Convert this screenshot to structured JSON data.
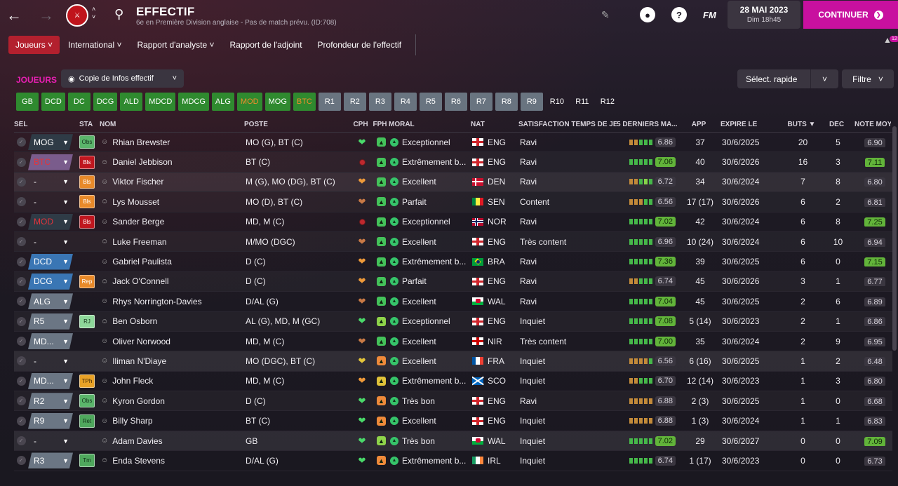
{
  "header": {
    "title": "EFFECTIF",
    "subtitle": "6e en Première Division anglaise - Pas de match prévu. (ID:708)",
    "date": "28 MAI 2023",
    "day_time": "Dim 18h45",
    "continue_label": "CONTINUER",
    "fm_logo": "FM",
    "help_label": "?",
    "notif_count": "12"
  },
  "menu": [
    "Joueurs",
    "International",
    "Rapport d'analyste",
    "Rapport de l'adjoint",
    "Profondeur de l'effectif"
  ],
  "section": {
    "title": "JOUEURS",
    "view": "Copie de Infos effectif",
    "quick_select": "Sélect. rapide",
    "filter": "Filtre"
  },
  "positions": [
    {
      "label": "GB",
      "style": "green"
    },
    {
      "label": "DCD",
      "style": "green"
    },
    {
      "label": "DC",
      "style": "green"
    },
    {
      "label": "DCG",
      "style": "green"
    },
    {
      "label": "ALD",
      "style": "green"
    },
    {
      "label": "MDCD",
      "style": "green"
    },
    {
      "label": "MDCG",
      "style": "green"
    },
    {
      "label": "ALG",
      "style": "green"
    },
    {
      "label": "MOD",
      "style": "orange"
    },
    {
      "label": "MOG",
      "style": "green"
    },
    {
      "label": "BTC",
      "style": "orange"
    },
    {
      "label": "R1",
      "style": "grey"
    },
    {
      "label": "R2",
      "style": "grey"
    },
    {
      "label": "R3",
      "style": "grey"
    },
    {
      "label": "R4",
      "style": "grey"
    },
    {
      "label": "R5",
      "style": "grey"
    },
    {
      "label": "R6",
      "style": "grey"
    },
    {
      "label": "R7",
      "style": "grey"
    },
    {
      "label": "R8",
      "style": "grey"
    },
    {
      "label": "R9",
      "style": "grey"
    },
    {
      "label": "R10",
      "style": "dark"
    },
    {
      "label": "R11",
      "style": "dark"
    },
    {
      "label": "R12",
      "style": "dark"
    }
  ],
  "columns": {
    "sel": "SÉL",
    "sta": "STA",
    "nom": "NOM",
    "poste": "POSTE",
    "cph": "CPH",
    "fph": "FPH",
    "moral": "MORAL",
    "nat": "NAT",
    "sat": "SATISFACTION TEMPS DE JEU",
    "form": "5 DERNIERS MA...",
    "app": "APP",
    "exp": "EXPIRE LE",
    "buts": "BUTS",
    "dec": "DÉC",
    "moy": "NOTE MOY"
  },
  "players": [
    {
      "pos": "MOG",
      "pos_style": "dark",
      "sta": "Obs",
      "sta_style": "obs",
      "name": "Rhian Brewster",
      "poste": "MO (G), BT (C)",
      "cph": "heart-g",
      "fph": "g",
      "moral": "Exceptionnel",
      "nat": "ENG",
      "sat": "Ravi",
      "form": "ooggg",
      "fr": "6.86",
      "fr_hi": false,
      "app": "37",
      "exp": "30/6/2025",
      "buts": "20",
      "dec": "5",
      "moy": "6.90",
      "moy_hi": false
    },
    {
      "pos": "BTC",
      "pos_style": "purple",
      "pos_red": true,
      "sta": "Bls",
      "sta_style": "bls",
      "name": "Daniel Jebbison",
      "poste": "BT (C)",
      "cph": "dot",
      "fph": "g",
      "moral": "Extrêmement b...",
      "nat": "ENG",
      "sat": "Ravi",
      "form": "ggggg",
      "fr": "7.06",
      "fr_hi": true,
      "app": "40",
      "exp": "30/6/2026",
      "buts": "16",
      "dec": "3",
      "moy": "7.11",
      "moy_hi": true
    },
    {
      "pos": "-",
      "pos_style": "none",
      "sta": "Bls",
      "sta_style": "bls-o",
      "name": "Viktor Fischer",
      "poste": "M (G), MO (DG), BT (C)",
      "cph": "heart-o",
      "fph": "g",
      "moral": "Excellent",
      "nat": "DEN",
      "sat": "Ravi",
      "form": "oogLg",
      "fr": "6.72",
      "fr_hi": false,
      "app": "34",
      "exp": "30/6/2024",
      "buts": "7",
      "dec": "8",
      "moy": "6.80",
      "moy_hi": false
    },
    {
      "pos": "-",
      "pos_style": "none",
      "sta": "Bls",
      "sta_style": "bls-o",
      "name": "Lys Mousset",
      "poste": "MO (D), BT (C)",
      "cph": "heart-b",
      "fph": "g",
      "moral": "Parfait",
      "nat": "SEN",
      "sat": "Content",
      "form": "ooogg",
      "fr": "6.56",
      "fr_hi": false,
      "app": "17 (17)",
      "exp": "30/6/2026",
      "buts": "6",
      "dec": "2",
      "moy": "6.81",
      "moy_hi": false
    },
    {
      "pos": "MOD",
      "pos_style": "dark",
      "pos_red": true,
      "sta": "Bls",
      "sta_style": "bls",
      "name": "Sander Berge",
      "poste": "MD, M (C)",
      "cph": "dot",
      "fph": "g",
      "moral": "Exceptionnel",
      "nat": "NOR",
      "sat": "Ravi",
      "form": "ggggg",
      "fr": "7.02",
      "fr_hi": true,
      "app": "42",
      "exp": "30/6/2024",
      "buts": "6",
      "dec": "8",
      "moy": "7.25",
      "moy_hi": true
    },
    {
      "pos": "-",
      "pos_style": "none",
      "sta": "",
      "sta_style": "",
      "name": "Luke Freeman",
      "poste": "M/MO (DGC)",
      "cph": "heart-b",
      "fph": "g",
      "moral": "Excellent",
      "nat": "ENG",
      "sat": "Très content",
      "form": "ggggg",
      "fr": "6.96",
      "fr_hi": false,
      "app": "10 (24)",
      "exp": "30/6/2024",
      "buts": "6",
      "dec": "10",
      "moy": "6.94",
      "moy_hi": false
    },
    {
      "pos": "DCD",
      "pos_style": "blue",
      "sta": "",
      "sta_style": "",
      "name": "Gabriel Paulista",
      "poste": "D (C)",
      "cph": "heart-o",
      "fph": "g",
      "moral": "Extrêmement b...",
      "nat": "BRA",
      "sat": "Ravi",
      "form": "ggggg",
      "fr": "7.36",
      "fr_hi": true,
      "app": "39",
      "exp": "30/6/2025",
      "buts": "6",
      "dec": "0",
      "moy": "7.15",
      "moy_hi": true
    },
    {
      "pos": "DCG",
      "pos_style": "blue",
      "sta": "Rep",
      "sta_style": "rep",
      "name": "Jack O'Connell",
      "poste": "D (C)",
      "cph": "heart-o",
      "fph": "g",
      "moral": "Parfait",
      "nat": "ENG",
      "sat": "Ravi",
      "form": "oogg g",
      "fr": "6.74",
      "fr_hi": false,
      "app": "45",
      "exp": "30/6/2026",
      "buts": "3",
      "dec": "1",
      "moy": "6.77",
      "moy_hi": false
    },
    {
      "pos": "ALG",
      "pos_style": "grey",
      "sta": "",
      "sta_style": "",
      "name": "Rhys Norrington-Davies",
      "poste": "D/AL (G)",
      "cph": "heart-b",
      "fph": "g",
      "moral": "Excellent",
      "nat": "WAL",
      "sat": "Ravi",
      "form": "ggggg",
      "fr": "7.04",
      "fr_hi": true,
      "app": "45",
      "exp": "30/6/2025",
      "buts": "2",
      "dec": "6",
      "moy": "6.89",
      "moy_hi": false
    },
    {
      "pos": "R5",
      "pos_style": "grey",
      "sta": "RJ",
      "sta_style": "rj",
      "name": "Ben Osborn",
      "poste": "AL (G), MD, M (GC)",
      "cph": "heart-g",
      "fph": "lg",
      "moral": "Exceptionnel",
      "nat": "ENG",
      "sat": "Inquiet",
      "form": "ggggg",
      "fr": "7.08",
      "fr_hi": true,
      "app": "5 (14)",
      "exp": "30/6/2023",
      "buts": "2",
      "dec": "1",
      "moy": "6.86",
      "moy_hi": false
    },
    {
      "pos": "MD...",
      "pos_style": "grey",
      "sta": "",
      "sta_style": "",
      "name": "Oliver Norwood",
      "poste": "MD, M (C)",
      "cph": "heart-b",
      "fph": "g",
      "moral": "Excellent",
      "nat": "NIR",
      "sat": "Très content",
      "form": "ggggg",
      "fr": "7.00",
      "fr_hi": true,
      "app": "35",
      "exp": "30/6/2024",
      "buts": "2",
      "dec": "9",
      "moy": "6.95",
      "moy_hi": false
    },
    {
      "pos": "-",
      "pos_style": "none",
      "sta": "",
      "sta_style": "",
      "name": "Iliman N'Diaye",
      "poste": "MO (DGC), BT (C)",
      "cph": "heart-y",
      "fph": "o",
      "moral": "Excellent",
      "nat": "FRA",
      "sat": "Inquiet",
      "form": "oooog",
      "fr": "6.56",
      "fr_hi": false,
      "app": "6 (16)",
      "exp": "30/6/2025",
      "buts": "1",
      "dec": "2",
      "moy": "6.48",
      "moy_hi": false
    },
    {
      "pos": "MD...",
      "pos_style": "grey",
      "sta": "TPh",
      "sta_style": "tph",
      "name": "John Fleck",
      "poste": "MD, M (C)",
      "cph": "heart-o",
      "fph": "y",
      "moral": "Extrêmement b...",
      "nat": "SCO",
      "sat": "Inquiet",
      "form": "ooggg",
      "fr": "6.70",
      "fr_hi": false,
      "app": "12 (14)",
      "exp": "30/6/2023",
      "buts": "1",
      "dec": "3",
      "moy": "6.80",
      "moy_hi": false
    },
    {
      "pos": "R2",
      "pos_style": "grey",
      "sta": "Obs",
      "sta_style": "obs",
      "name": "Kyron Gordon",
      "poste": "D (C)",
      "cph": "heart-g",
      "fph": "o",
      "moral": "Très bon",
      "nat": "ENG",
      "sat": "Ravi",
      "form": "ooooo",
      "fr": "6.88",
      "fr_hi": false,
      "app": "2 (3)",
      "exp": "30/6/2025",
      "buts": "1",
      "dec": "0",
      "moy": "6.68",
      "moy_hi": false
    },
    {
      "pos": "R9",
      "pos_style": "grey",
      "sta": "Ret",
      "sta_style": "ret",
      "name": "Billy Sharp",
      "poste": "BT (C)",
      "cph": "heart-g",
      "fph": "o",
      "moral": "Excellent",
      "nat": "ENG",
      "sat": "Inquiet",
      "form": "ooooo",
      "fr": "6.88",
      "fr_hi": false,
      "app": "1 (3)",
      "exp": "30/6/2024",
      "buts": "1",
      "dec": "1",
      "moy": "6.83",
      "moy_hi": false
    },
    {
      "pos": "-",
      "pos_style": "none",
      "sta": "",
      "sta_style": "",
      "name": "Adam Davies",
      "poste": "GB",
      "cph": "heart-g",
      "fph": "lg",
      "moral": "Très bon",
      "nat": "WAL",
      "sat": "Inquiet",
      "form": "ggggg",
      "fr": "7.02",
      "fr_hi": true,
      "app": "29",
      "exp": "30/6/2027",
      "buts": "0",
      "dec": "0",
      "moy": "7.09",
      "moy_hi": true
    },
    {
      "pos": "R3",
      "pos_style": "grey",
      "sta": "Tm",
      "sta_style": "tm",
      "name": "Enda Stevens",
      "poste": "D/AL (G)",
      "cph": "heart-g",
      "fph": "o",
      "moral": "Extrêmement b...",
      "nat": "IRL",
      "sat": "Inquiet",
      "form": "ggggg",
      "fr": "6.74",
      "fr_hi": false,
      "app": "1 (17)",
      "exp": "30/6/2023",
      "buts": "0",
      "dec": "0",
      "moy": "6.73",
      "moy_hi": false
    }
  ],
  "colors": {
    "accent": "#c8109f",
    "active_menu": "#b3202e",
    "section_title": "#e81fb3"
  }
}
